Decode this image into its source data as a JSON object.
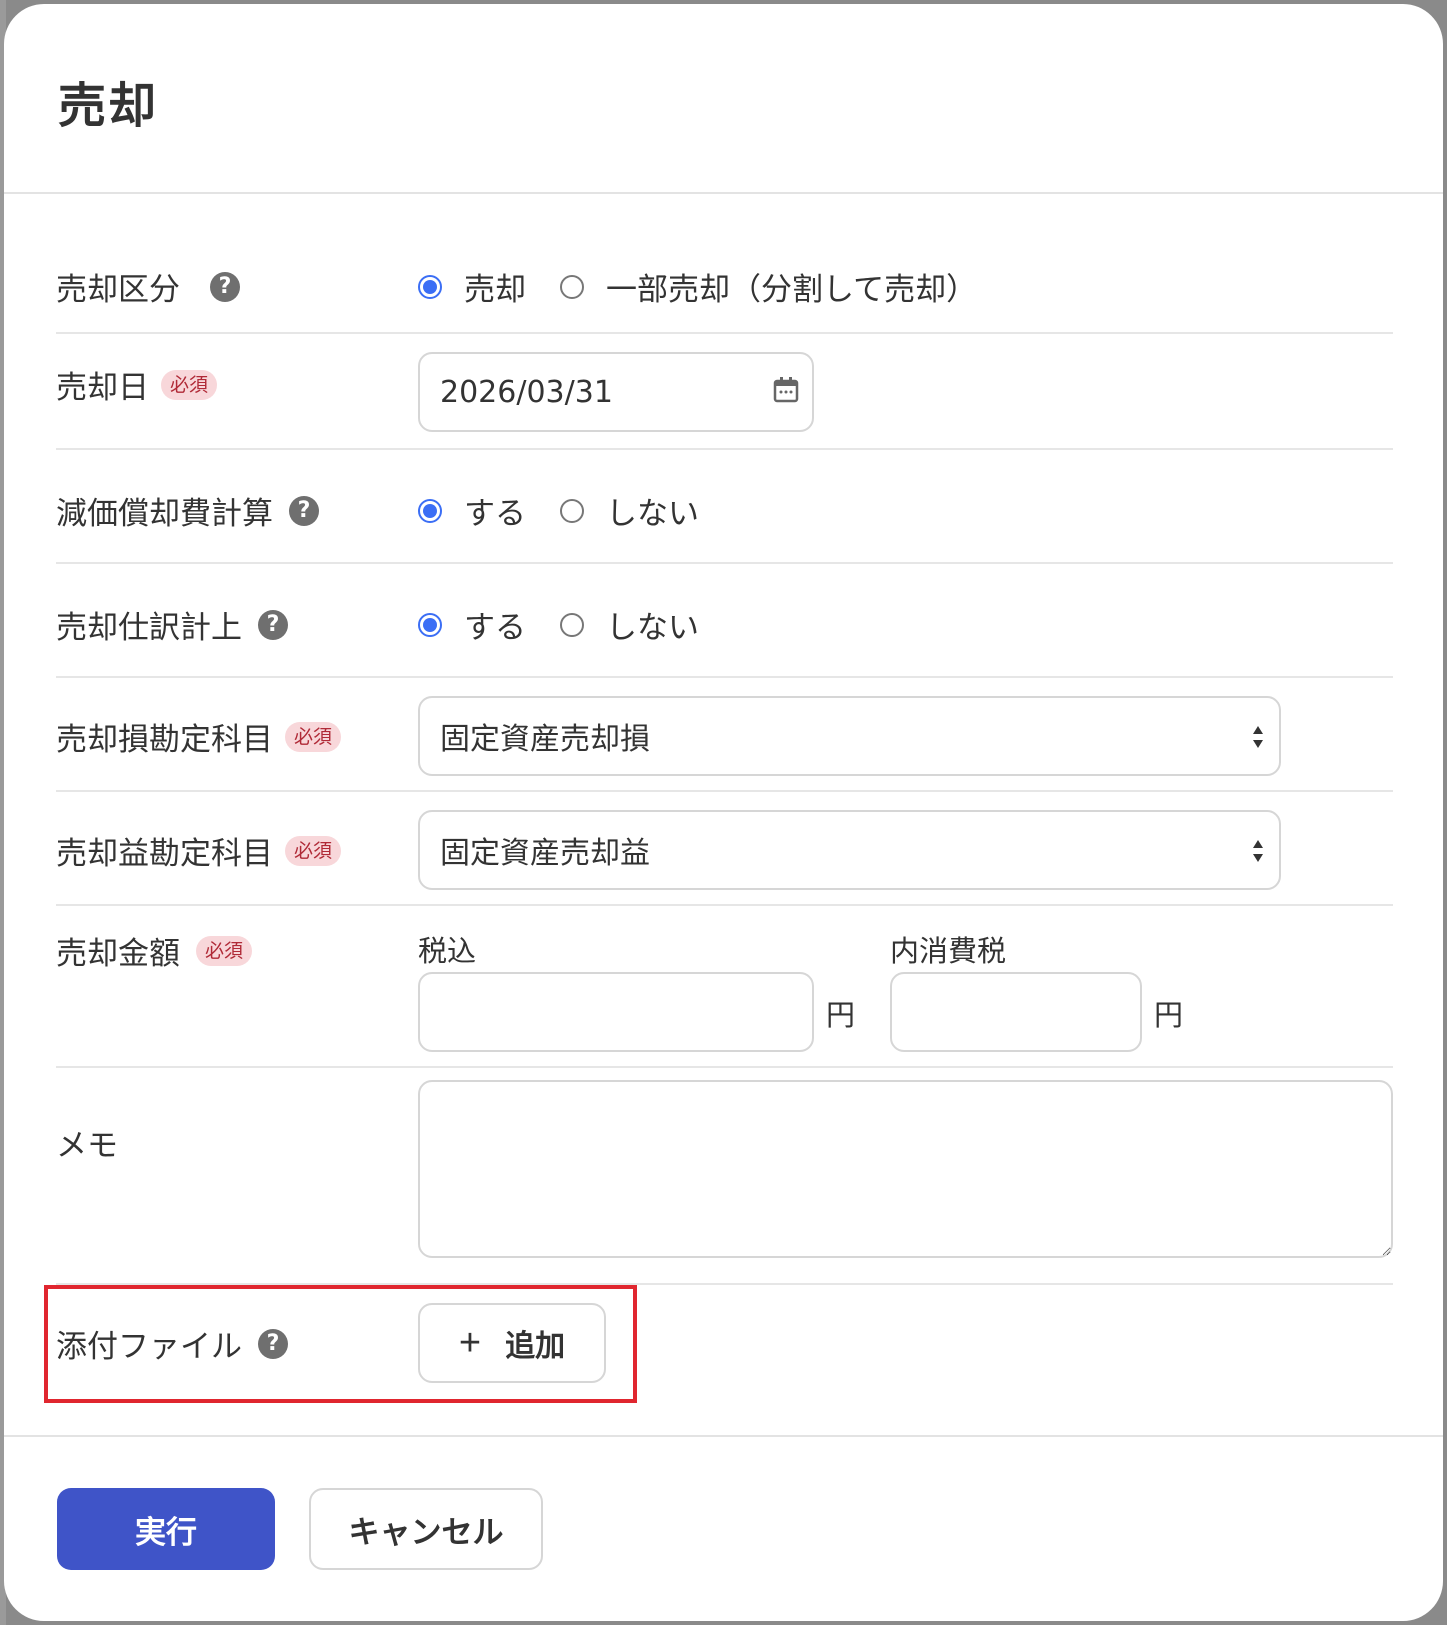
{
  "dialog": {
    "title": "売却"
  },
  "fields": {
    "sale_type": {
      "label": "売却区分",
      "options": [
        "売却",
        "一部売却（分割して売却）"
      ],
      "selected": "売却"
    },
    "sale_date": {
      "label": "売却日",
      "required_badge": "必須",
      "value": "2026/03/31"
    },
    "depreciation_calc": {
      "label": "減価償却費計算",
      "options": [
        "する",
        "しない"
      ],
      "selected": "する"
    },
    "journal_entry": {
      "label": "売却仕訳計上",
      "options": [
        "する",
        "しない"
      ],
      "selected": "する"
    },
    "loss_account": {
      "label": "売却損勘定科目",
      "required_badge": "必須",
      "value": "固定資産売却損"
    },
    "gain_account": {
      "label": "売却益勘定科目",
      "required_badge": "必須",
      "value": "固定資産売却益"
    },
    "sale_amount": {
      "label": "売却金額",
      "required_badge": "必須",
      "tax_included_label": "税込",
      "tax_included_value": "",
      "consumption_tax_label": "内消費税",
      "consumption_tax_value": "",
      "unit": "円"
    },
    "memo": {
      "label": "メモ",
      "value": ""
    },
    "attachment": {
      "label": "添付ファイル",
      "add_button": "追加"
    }
  },
  "help_icon_text": "?",
  "footer": {
    "execute_button": "実行",
    "cancel_button": "キャンセル"
  },
  "colors": {
    "primary": "#3f54c8",
    "radio_checked": "#3b6ef5",
    "required_bg": "#f8d7da",
    "highlight": "#e0262f"
  }
}
